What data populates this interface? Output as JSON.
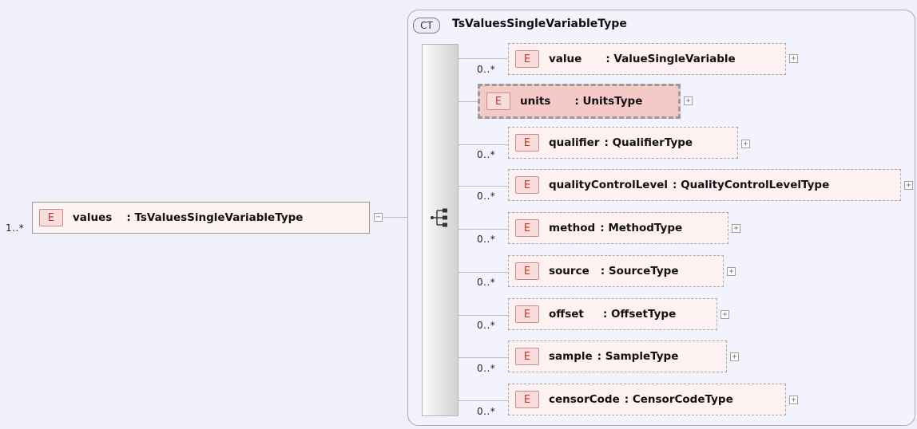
{
  "root": {
    "multiplicity": "1..*",
    "badge": "E",
    "name": "values",
    "type": ": TsValuesSingleVariableType",
    "expander": "−"
  },
  "complex_type": {
    "badge": "CT",
    "name": "TsValuesSingleVariableType"
  },
  "children": [
    {
      "multiplicity": "0..*",
      "badge": "E",
      "name": "value",
      "type": ": ValueSingleVariable",
      "expander": "+"
    },
    {
      "multiplicity": "",
      "badge": "E",
      "name": "units",
      "type": ": UnitsType",
      "expander": "+"
    },
    {
      "multiplicity": "0..*",
      "badge": "E",
      "name": "qualifier",
      "type": ": QualifierType",
      "expander": "+"
    },
    {
      "multiplicity": "0..*",
      "badge": "E",
      "name": "qualityControlLevel",
      "type": ": QualityControlLevelType",
      "expander": "+"
    },
    {
      "multiplicity": "0..*",
      "badge": "E",
      "name": "method",
      "type": ": MethodType",
      "expander": "+"
    },
    {
      "multiplicity": "0..*",
      "badge": "E",
      "name": "source",
      "type": ": SourceType",
      "expander": "+"
    },
    {
      "multiplicity": "0..*",
      "badge": "E",
      "name": "offset",
      "type": ": OffsetType",
      "expander": "+"
    },
    {
      "multiplicity": "0..*",
      "badge": "E",
      "name": "sample",
      "type": ": SampleType",
      "expander": "+"
    },
    {
      "multiplicity": "0..*",
      "badge": "E",
      "name": "censorCode",
      "type": ": CensorCodeType",
      "expander": "+"
    }
  ],
  "compositor": {
    "icon": "sequence-compositor-icon"
  },
  "colors": {
    "element_fill": "#fdf1f1",
    "required_fill": "#f6c9c9",
    "badge_text": "#c0392b",
    "ct_border": "#a7a7c4"
  }
}
